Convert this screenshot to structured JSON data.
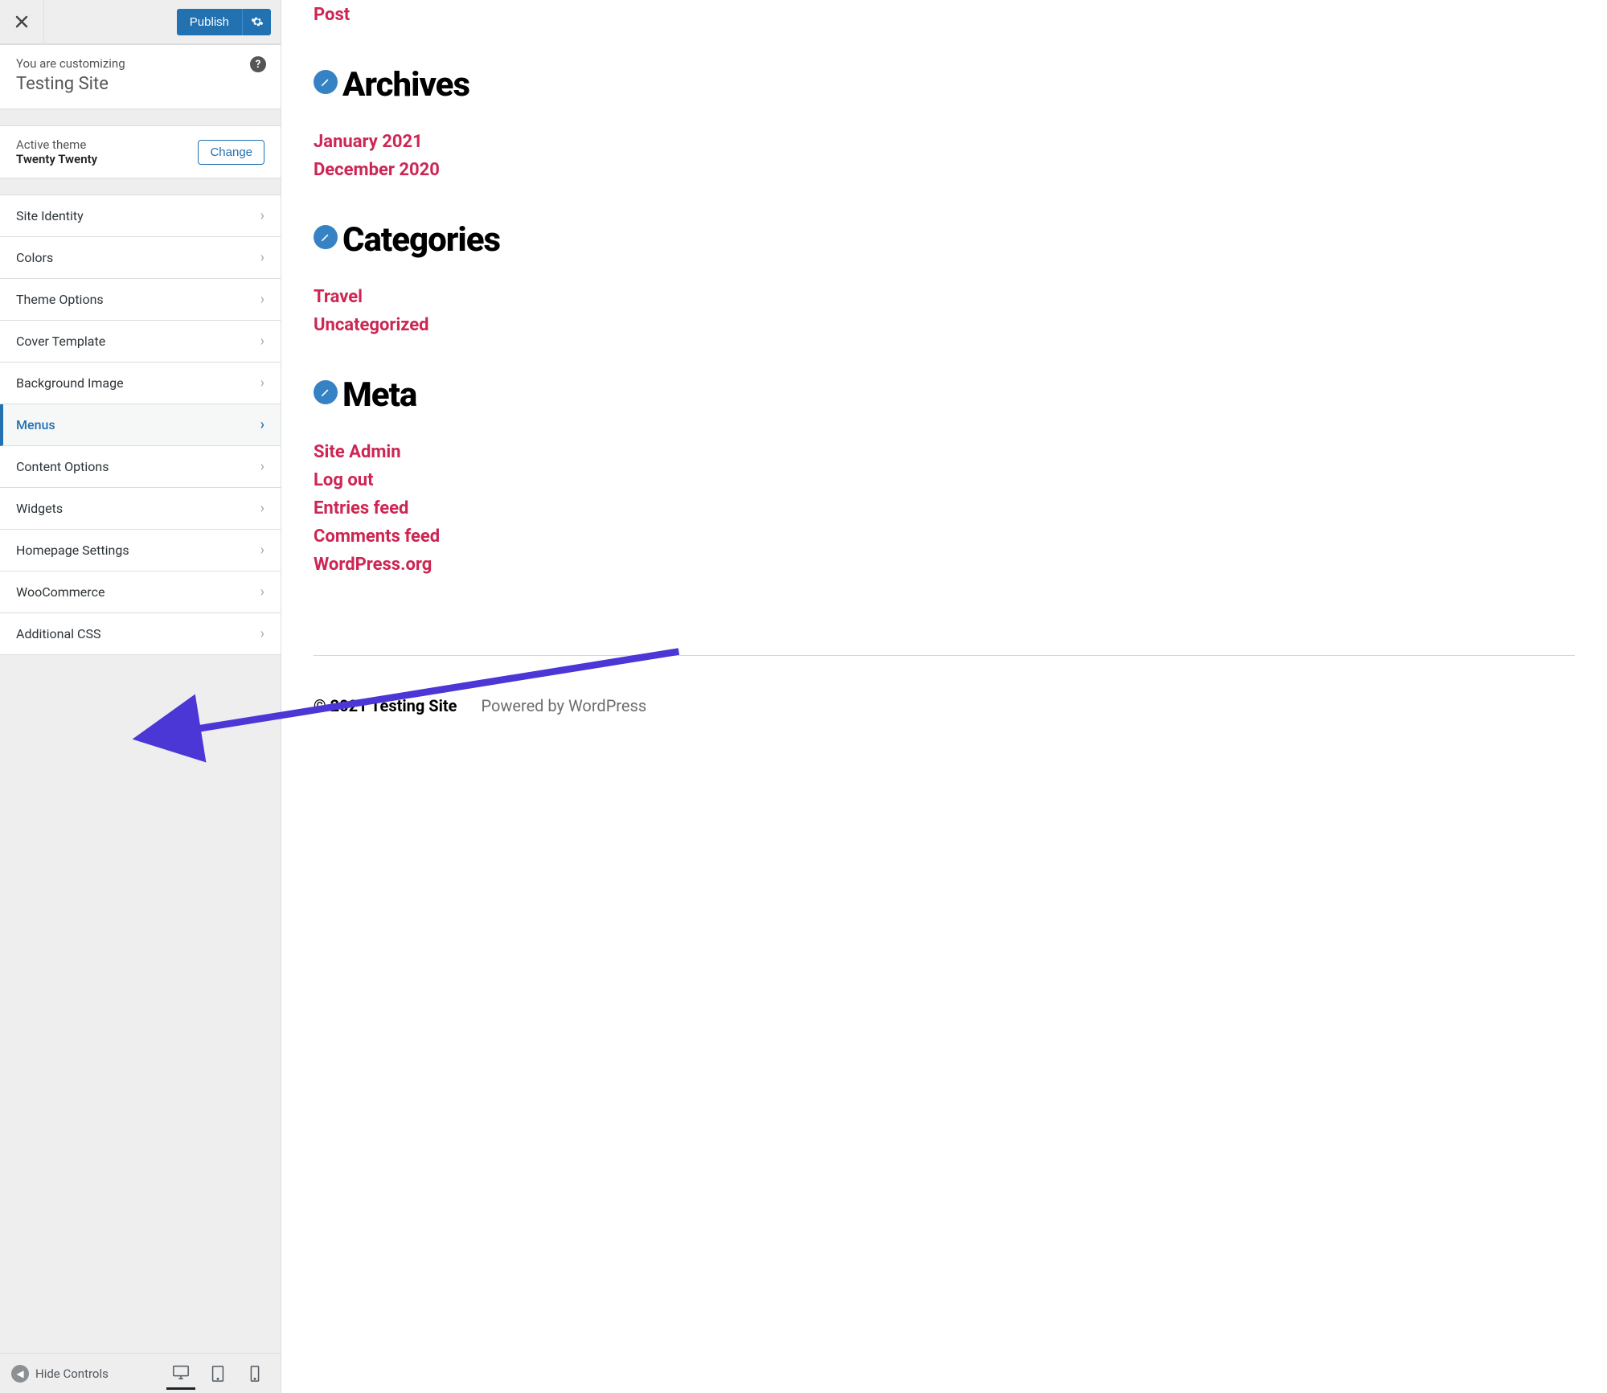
{
  "header": {
    "publish_label": "Publish"
  },
  "customizing": {
    "prefix": "You are customizing",
    "site_name": "Testing Site"
  },
  "theme": {
    "label": "Active theme",
    "name": "Twenty Twenty",
    "change_label": "Change"
  },
  "nav": {
    "items": [
      {
        "label": "Site Identity"
      },
      {
        "label": "Colors"
      },
      {
        "label": "Theme Options"
      },
      {
        "label": "Cover Template"
      },
      {
        "label": "Background Image"
      },
      {
        "label": "Menus"
      },
      {
        "label": "Content Options"
      },
      {
        "label": "Widgets"
      },
      {
        "label": "Homepage Settings"
      },
      {
        "label": "WooCommerce"
      },
      {
        "label": "Additional CSS"
      }
    ]
  },
  "devicebar": {
    "hide_label": "Hide Controls"
  },
  "preview": {
    "top_link": "Post",
    "archives": {
      "heading": "Archives",
      "items": [
        "January 2021",
        "December 2020"
      ]
    },
    "categories": {
      "heading": "Categories",
      "items": [
        "Travel",
        "Uncategorized"
      ]
    },
    "meta": {
      "heading": "Meta",
      "items": [
        "Site Admin",
        "Log out",
        "Entries feed",
        "Comments feed",
        "WordPress.org"
      ]
    },
    "footer": {
      "copyright": "© 2021 Testing Site",
      "powered": "Powered by WordPress"
    }
  }
}
